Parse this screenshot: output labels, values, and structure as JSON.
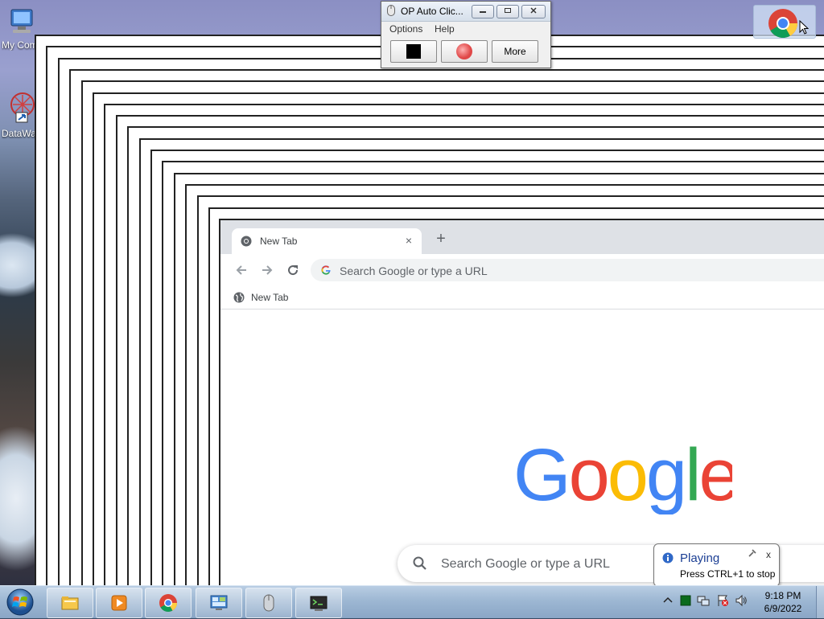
{
  "desktop": {
    "icons": [
      {
        "label": "My Computer",
        "icon": "computer-icon"
      },
      {
        "label": "DataWarrior",
        "icon": "datawarrior-icon"
      }
    ]
  },
  "autoclicker": {
    "title": "OP Auto Clic...",
    "menu": [
      "Options",
      "Help"
    ],
    "buttons": {
      "stop": "stop-square-icon",
      "record": "record-circle-icon",
      "more": "More"
    },
    "caption_buttons": [
      "minimize",
      "restore",
      "close"
    ]
  },
  "chrome": {
    "tab_title": "New Tab",
    "tab_close": "×",
    "new_tab": "+",
    "omnibox_placeholder": "Search Google or type a URL",
    "bookmark_label": "New Tab",
    "ntp_search_placeholder": "Search Google or type a URL",
    "logo": "Google",
    "colors": {
      "blue": "#4285F4",
      "red": "#EA4335",
      "yellow": "#FBBC05",
      "green": "#34A853"
    }
  },
  "taskbar": {
    "pinned": [
      "file-explorer-icon",
      "media-player-icon",
      "chrome-icon",
      "control-panel-icon",
      "mouse-icon",
      "terminal-icon"
    ],
    "clock_time": "9:18 PM",
    "clock_date": "6/9/2022"
  },
  "balloon": {
    "title": "Playing",
    "message": "Press CTRL+1 to stop",
    "close": "x"
  }
}
